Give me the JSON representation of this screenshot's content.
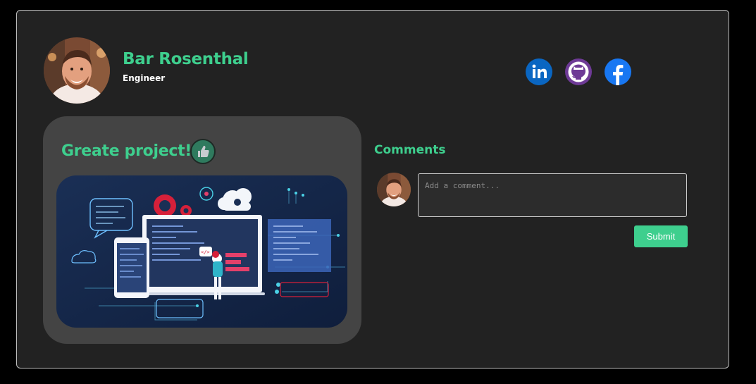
{
  "profile": {
    "name": "Bar Rosenthal",
    "role": "Engineer"
  },
  "social": {
    "linkedin_icon": "linkedin-icon",
    "github_icon": "github-icon",
    "facebook_icon": "facebook-icon"
  },
  "post": {
    "title": "Greate project!",
    "like_icon": "thumbs-up-icon"
  },
  "comments": {
    "title": "Comments",
    "placeholder": "Add a comment...",
    "value": "",
    "submit_label": "Submit"
  },
  "colors": {
    "accent": "#3ecf8e",
    "card_background": "#222222",
    "post_background": "#444444",
    "linkedin": "#0a66c2",
    "github": "#6e3a96",
    "facebook": "#1877f2"
  }
}
